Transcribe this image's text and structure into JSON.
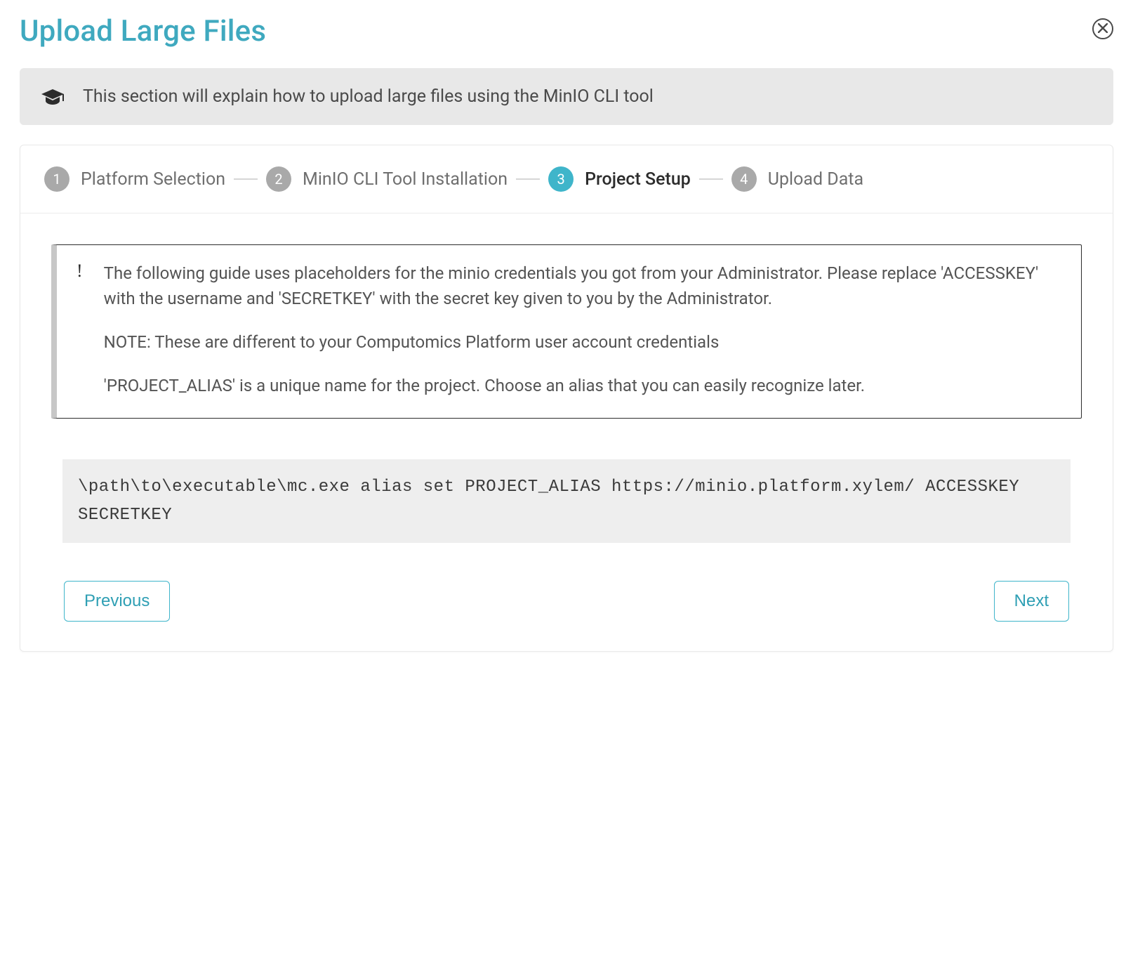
{
  "header": {
    "title": "Upload Large Files"
  },
  "info": {
    "text": "This section will explain how to upload large files using the MinIO CLI tool"
  },
  "stepper": {
    "steps": [
      {
        "num": "1",
        "label": "Platform Selection"
      },
      {
        "num": "2",
        "label": "MinIO CLI Tool Installation"
      },
      {
        "num": "3",
        "label": "Project Setup"
      },
      {
        "num": "4",
        "label": "Upload Data"
      }
    ],
    "active_index": 2
  },
  "notice": {
    "p1": " The following guide uses placeholders for the minio credentials you got from your Administrator. Please replace 'ACCESSKEY' with the username and 'SECRETKEY' with the secret key given to you by the Administrator.",
    "p2": "NOTE: These are different to your Computomics Platform user account credentials",
    "p3": "'PROJECT_ALIAS' is a unique name for the project. Choose an alias that you can easily recognize later."
  },
  "code": "\\path\\to\\executable\\mc.exe alias set PROJECT_ALIAS https://minio.platform.xylem/ ACCESSKEY SECRETKEY",
  "buttons": {
    "previous": "Previous",
    "next": "Next"
  }
}
